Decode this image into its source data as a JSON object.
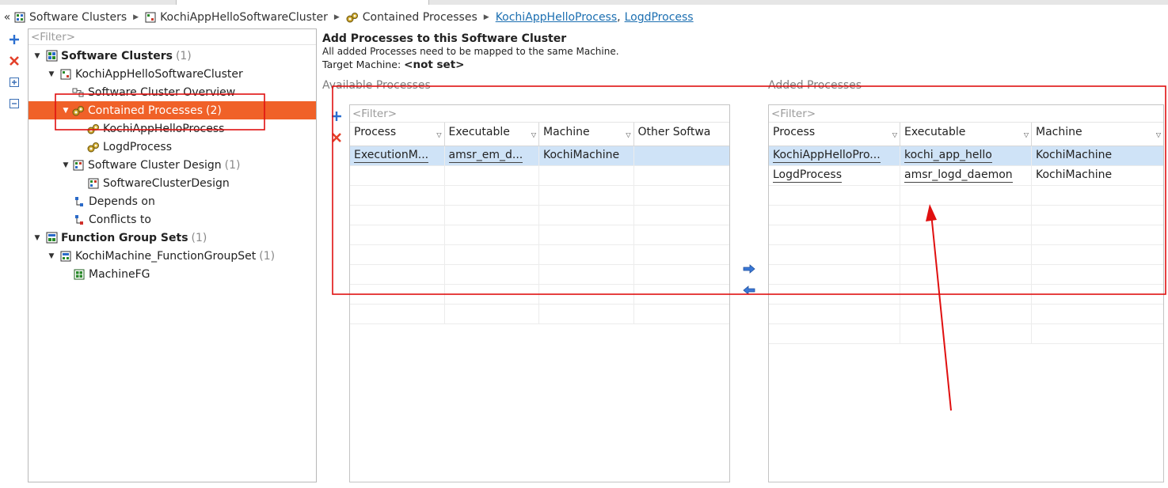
{
  "breadcrumb": {
    "back_label": "«",
    "items": [
      {
        "label": "Software Clusters"
      },
      {
        "label": "KochiAppHelloSoftwareCluster"
      },
      {
        "label": "Contained Processes"
      }
    ],
    "links": [
      "KochiAppHelloProcess",
      "LogdProcess"
    ],
    "link_separator": ","
  },
  "tree": {
    "filter_placeholder": "<Filter>",
    "rows": [
      {
        "label": "Software Clusters",
        "count": "(1)"
      },
      {
        "label": "KochiAppHelloSoftwareCluster",
        "count": ""
      },
      {
        "label": "Software Cluster Overview",
        "count": ""
      },
      {
        "label": "Contained Processes",
        "count": "(2)"
      },
      {
        "label": "KochiAppHelloProcess",
        "count": ""
      },
      {
        "label": "LogdProcess",
        "count": ""
      },
      {
        "label": "Software Cluster Design",
        "count": "(1)"
      },
      {
        "label": "SoftwareClusterDesign",
        "count": ""
      },
      {
        "label": "Depends on",
        "count": ""
      },
      {
        "label": "Conflicts to",
        "count": ""
      },
      {
        "label": "Function Group Sets",
        "count": "(1)"
      },
      {
        "label": "KochiMachine_FunctionGroupSet",
        "count": "(1)"
      },
      {
        "label": "MachineFG",
        "count": ""
      }
    ]
  },
  "main": {
    "title": "Add Processes to this Software Cluster",
    "subtitle": "All added Processes need to be mapped to the same Machine.",
    "target_label": "Target Machine:",
    "target_value": "<not set>"
  },
  "available": {
    "label": "Available Processes",
    "filter_placeholder": "<Filter>",
    "columns": [
      "Process",
      "Executable",
      "Machine",
      "Other Softwa"
    ],
    "rows": [
      [
        "ExecutionM...",
        "amsr_em_d...",
        "KochiMachine",
        ""
      ]
    ]
  },
  "added": {
    "label": "Added Processes",
    "filter_placeholder": "<Filter>",
    "columns": [
      "Process",
      "Executable",
      "Machine"
    ],
    "rows": [
      [
        "KochiAppHelloPro...",
        "kochi_app_hello",
        "KochiMachine"
      ],
      [
        "LogdProcess",
        "amsr_logd_daemon",
        "KochiMachine"
      ]
    ]
  },
  "colors": {
    "selection": "#f06128",
    "row_selection": "#cfe3f7",
    "annotation": "#e01010",
    "link": "#1c6fb1"
  }
}
